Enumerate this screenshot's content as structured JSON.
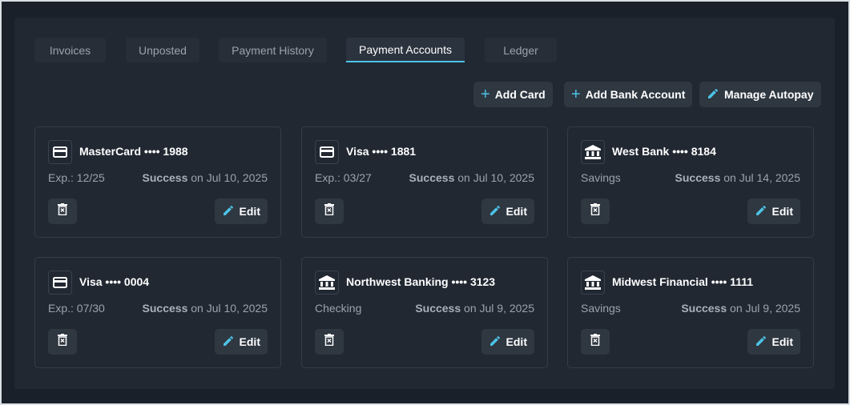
{
  "tabs": [
    {
      "label": "Invoices"
    },
    {
      "label": "Unposted"
    },
    {
      "label": "Payment History"
    },
    {
      "label": "Payment Accounts",
      "active": true
    },
    {
      "label": "Ledger"
    }
  ],
  "actions": {
    "add_card": "Add Card",
    "add_bank": "Add Bank Account",
    "manage_autopay": "Manage Autopay"
  },
  "accent": "#4cc3e6",
  "accounts": [
    {
      "type": "card",
      "name": "MasterCard •••• 1988",
      "sub": "Exp.: 12/25",
      "status": "Success",
      "date": "on Jul 10, 2025"
    },
    {
      "type": "card",
      "name": "Visa •••• 1881",
      "sub": "Exp.: 03/27",
      "status": "Success",
      "date": "on Jul 10, 2025"
    },
    {
      "type": "bank",
      "name": "West Bank •••• 8184",
      "sub": "Savings",
      "status": "Success",
      "date": "on Jul 14, 2025"
    },
    {
      "type": "card",
      "name": "Visa •••• 0004",
      "sub": "Exp.: 07/30",
      "status": "Success",
      "date": "on Jul 10, 2025"
    },
    {
      "type": "bank",
      "name": "Northwest Banking •••• 3123",
      "sub": "Checking",
      "status": "Success",
      "date": "on Jul 9, 2025"
    },
    {
      "type": "bank",
      "name": "Midwest Financial •••• 1111",
      "sub": "Savings",
      "status": "Success",
      "date": "on Jul 9, 2025"
    }
  ],
  "edit_label": "Edit"
}
